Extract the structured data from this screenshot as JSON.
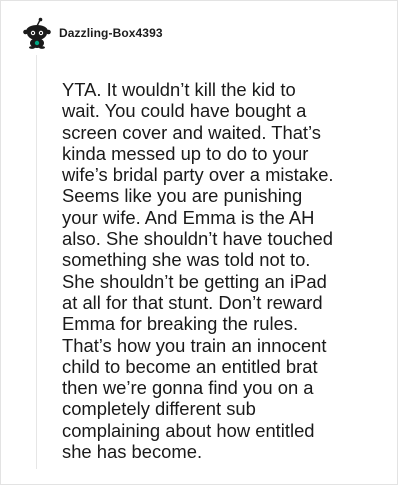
{
  "comment": {
    "author": "Dazzling-Box4393",
    "avatar_icon": "snoo-avatar-icon",
    "body": "YTA. It wouldn’t kill the kid to\nwait. You could have bought a\nscreen cover and waited. That’s\nkinda messed up to do to your\nwife’s bridal party over a mistake.\nSeems like you are punishing\nyour wife. And Emma is the AH\nalso. She shouldn’t have touched\nsomething she was told not to.\nShe shouldn’t be getting an iPad\nat all for that stunt. Don’t reward\nEmma for breaking the rules.\nThat’s how you train an innocent\nchild to become an entitled brat\nthen we’re gonna find you on a\ncompletely different sub\ncomplaining about how entitled\nshe has become."
  },
  "colors": {
    "text": "#1a1a1a",
    "border": "#e3e3e3",
    "thread_line": "#e6e6e6",
    "avatar_dark": "#1a1a1a",
    "avatar_accent": "#00a884"
  }
}
